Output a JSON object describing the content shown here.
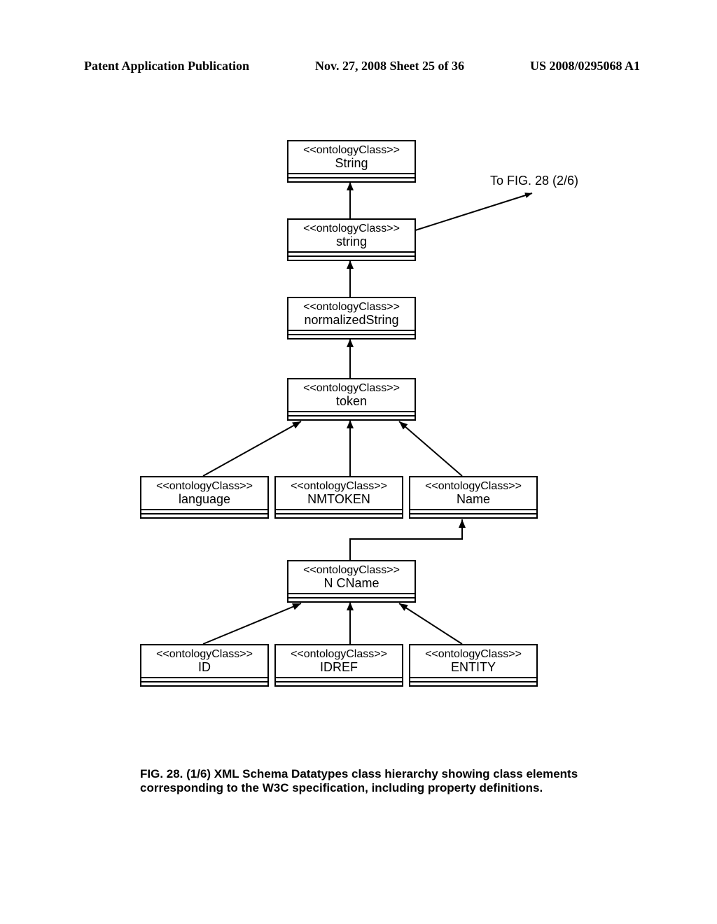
{
  "header": {
    "left": "Patent Application Publication",
    "center": "Nov. 27, 2008  Sheet 25 of 36",
    "right": "US 2008/0295068 A1"
  },
  "stereotype": "<<ontologyClass>>",
  "nodes": {
    "n1": "String",
    "n2": "string",
    "n3": "normalizedString",
    "n4": "token",
    "n5": "language",
    "n6": "NMTOKEN",
    "n7": "Name",
    "n8": "N CName",
    "n9": "ID",
    "n10": "IDREF",
    "n11": "ENTITY"
  },
  "offpage_label": "To FIG. 28 (2/6)",
  "caption": "FIG. 28. (1/6)  XML Schema Datatypes class hierarchy showing class elements corresponding to the W3C specification, including property definitions."
}
